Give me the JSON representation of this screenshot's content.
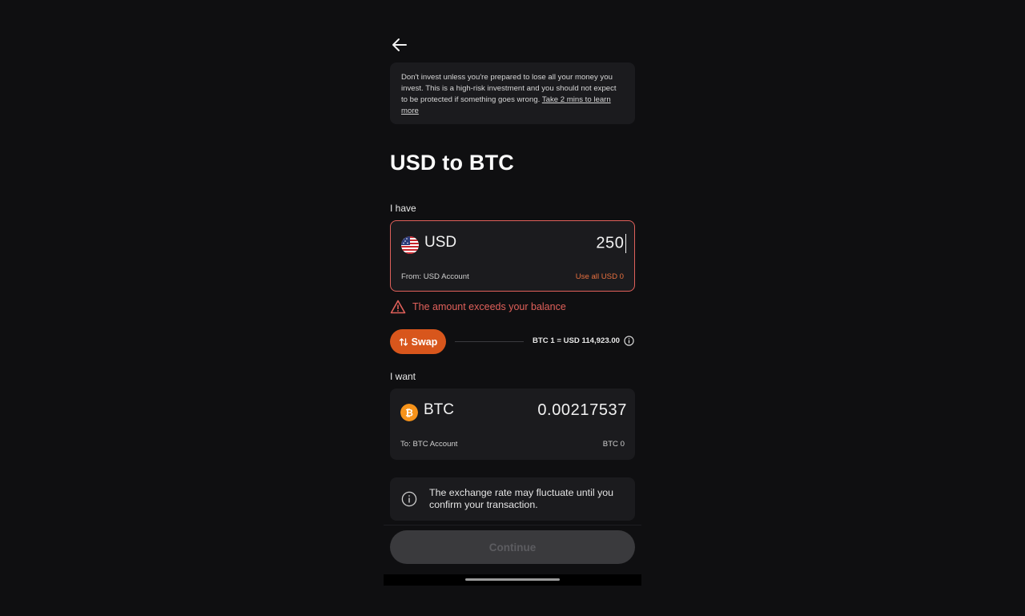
{
  "warning": {
    "text": "Don't invest unless you're prepared to lose all your money you invest. This is a high-risk investment and you should not expect to be protected if something goes wrong.",
    "link": "Take 2 mins to learn more"
  },
  "page_title": "USD to BTC",
  "have": {
    "label": "I have",
    "currency": "USD",
    "amount": "250",
    "from_label": "From: USD Account",
    "use_all": "Use all USD 0",
    "flag_icon": "us-flag-icon"
  },
  "error": {
    "text": "The amount exceeds your balance",
    "color": "#e0605a"
  },
  "swap": {
    "label": "Swap",
    "rate": "BTC 1 = USD 114,923.00"
  },
  "want": {
    "label": "I want",
    "currency": "BTC",
    "amount": "0.00217537",
    "to_label": "To: BTC Account",
    "balance": "BTC 0",
    "coin_icon": "bitcoin-icon"
  },
  "notice": {
    "text": "The exchange rate may fluctuate until you confirm your transaction."
  },
  "continue_label": "Continue",
  "colors": {
    "accent": "#d8561c",
    "error": "#e0605a",
    "background": "#0f0f11",
    "card": "#1b1b1e"
  }
}
